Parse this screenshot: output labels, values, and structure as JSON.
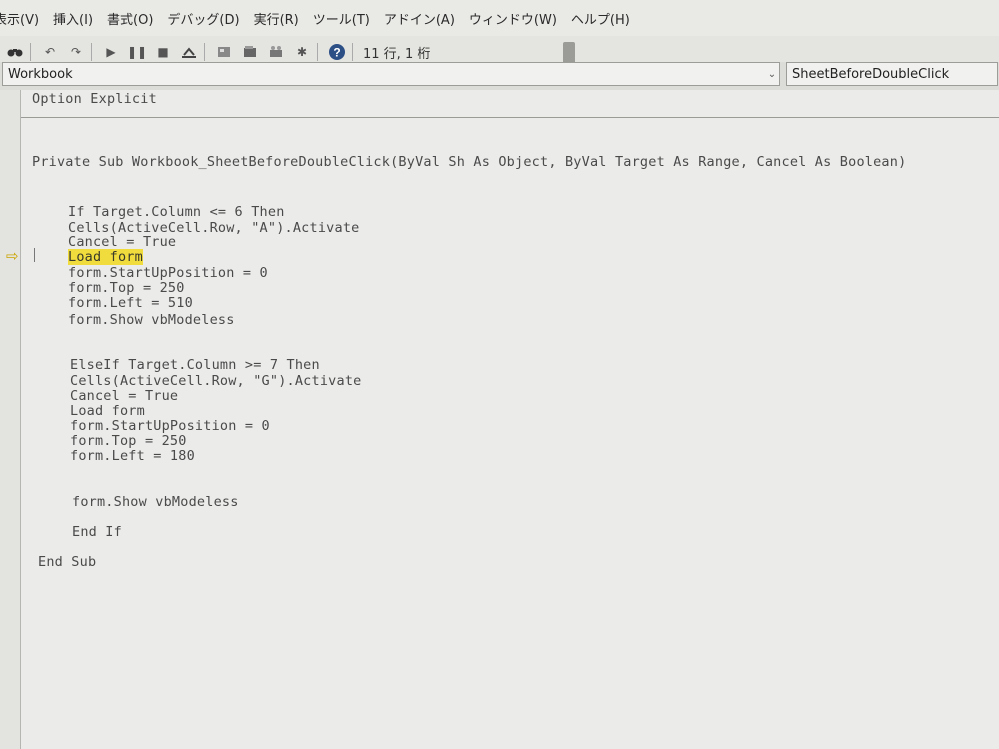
{
  "menu": [
    "表示(V)",
    "挿入(I)",
    "書式(O)",
    "デバッグ(D)",
    "実行(R)",
    "ツール(T)",
    "アドイン(A)",
    "ウィンドウ(W)",
    "ヘルプ(H)"
  ],
  "toolbar": {
    "icons": [
      "find-icon",
      "undo-icon",
      "redo-icon",
      "run-icon",
      "break-icon",
      "reset-icon",
      "design-mode-icon",
      "project-explorer-icon",
      "properties-icon",
      "object-browser-icon",
      "toolbox-icon",
      "help-icon"
    ],
    "position_label": "11 行, 1 桁"
  },
  "selectors": {
    "object": "Workbook",
    "procedure": "SheetBeforeDoubleClick"
  },
  "code": {
    "line_option": "Option Explicit",
    "line_sub": "Private Sub Workbook_SheetBeforeDoubleClick(ByVal Sh As Object, ByVal Target As Range, Cancel As Boolean)",
    "line_if": "If Target.Column <= 6 Then",
    "line_cells_a": "Cells(ActiveCell.Row, \"A\").Activate",
    "line_cancel_1": "Cancel = True",
    "line_load_1": "Load form",
    "line_startup_1": "form.StartUpPosition = 0",
    "line_top_1": "form.Top = 250",
    "line_left_1": "form.Left = 510",
    "line_show_1": "form.Show vbModeless",
    "line_elseif": "ElseIf Target.Column >= 7 Then",
    "line_cells_g": "Cells(ActiveCell.Row, \"G\").Activate",
    "line_cancel_2": "Cancel = True",
    "line_load_2": "Load form",
    "line_startup_2": "form.StartUpPosition = 0",
    "line_top_2": "form.Top = 250",
    "line_left_2": "form.Left = 180",
    "line_show_2": "form.Show vbModeless",
    "line_endif": "End If",
    "line_endsub": "End Sub"
  },
  "colors": {
    "highlight": "#f0dc3c",
    "exec_arrow": "#c9a400"
  }
}
